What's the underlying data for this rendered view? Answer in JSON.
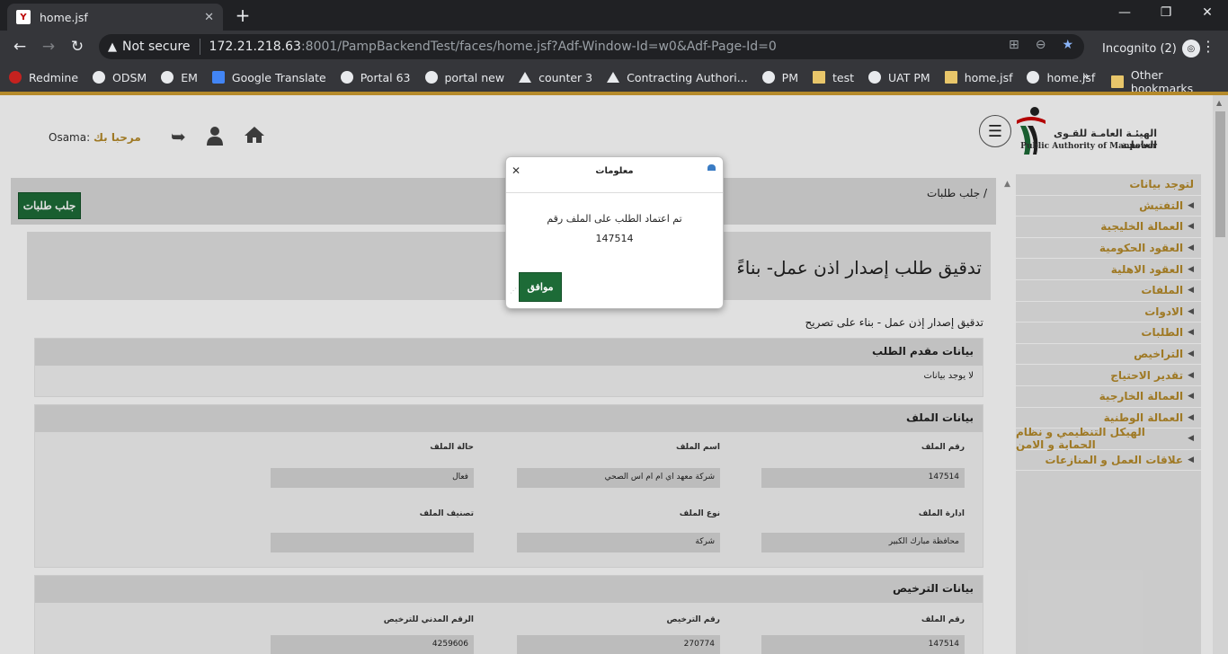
{
  "browser": {
    "tab_title": "home.jsf",
    "not_secure_label": "Not secure",
    "url_host": "172.21.218.63",
    "url_rest": ":8001/PampBackendTest/faces/home.jsf?Adf-Window-Id=w0&Adf-Page-Id=0",
    "incognito_label": "Incognito (2)",
    "bookmarks": [
      "Redmine",
      "ODSM",
      "EM",
      "Google Translate",
      "Portal 63",
      "portal new",
      "counter 3",
      "Contracting Authori...",
      "PM",
      "test",
      "UAT PM",
      "home.jsf",
      "home.jsf"
    ],
    "bookmark_overflow": "»",
    "other_bookmarks": "Other bookmarks"
  },
  "header": {
    "logo_ar": "الهيئـة العامـة للقـوى العاملـة",
    "logo_en": "Public Authority of Manpower",
    "greeting": "مرحبا بك",
    "username": "Osama:"
  },
  "toolbar": {
    "breadcrumb": "جلب طلبات /",
    "fetch_label": "جلب طلبات"
  },
  "main": {
    "title": "تدقيق طلب إصدار اذن عمل- بناءً",
    "subtitle": "تدقيق إصدار إذن عمل - بناء على تصريح"
  },
  "sections": {
    "applicant": {
      "title": "بيانات مقدم الطلب",
      "no_data": "لا يوجد بيانات"
    },
    "file": {
      "title": "بيانات الملف",
      "labels": [
        "رقم الملف",
        "اسم الملف",
        "حالة الملف",
        "ادارة الملف",
        "نوع الملف",
        "تصنيف الملف"
      ],
      "values": [
        "147514",
        "شركة معهد اي ام ام اس الصحي",
        "فعال",
        "محافظة مبارك الكبير",
        "شركة",
        ""
      ]
    },
    "license": {
      "title": "بيانات الترخيص",
      "labels": [
        "رقم الملف",
        "رقم الترخيص",
        "الرقم المدني للترخيص"
      ],
      "values": [
        "147514",
        "270774",
        "4259606"
      ]
    }
  },
  "sidebar": {
    "items": [
      "لتوجد بيانات",
      "التفتيش",
      "العمالة الخليجية",
      "العقود الحكومية",
      "العقود الاهلية",
      "الملفات",
      "الادوات",
      "الطلبات",
      "التراخيص",
      "تقدير الاحتياج",
      "العمالة الخارجية",
      "العمالة الوطنية",
      "الهيكل التنظيمي و نظام الحماية و الامن",
      "علاقات العمل و المنازعات"
    ]
  },
  "dialog": {
    "title": "معلومات",
    "message": "تم اعتماد الطلب على الملف رقم",
    "number": "147514",
    "ok_label": "موافق"
  }
}
